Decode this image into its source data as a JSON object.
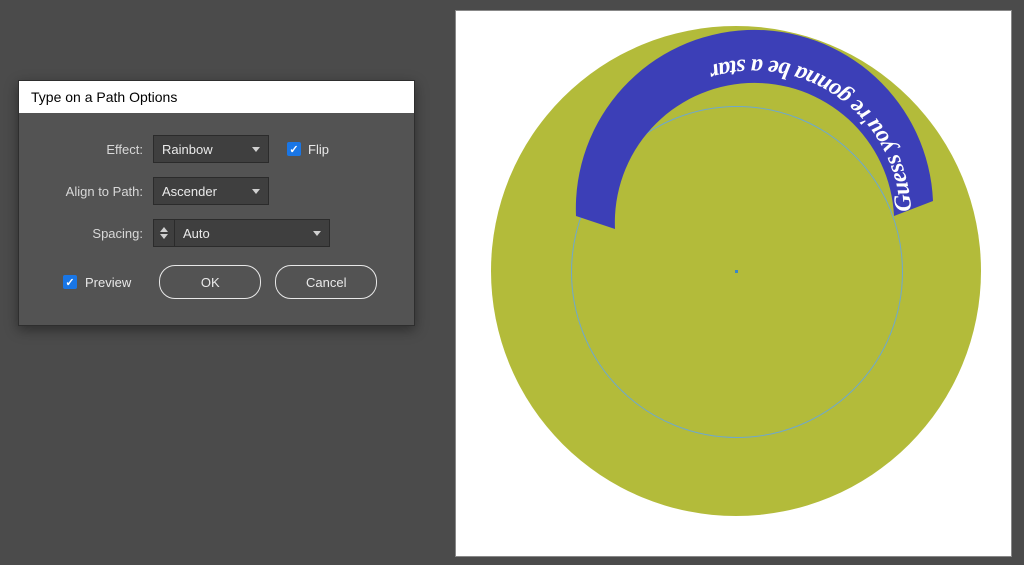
{
  "dialog": {
    "title": "Type on a Path Options",
    "effect_label": "Effect:",
    "effect_value": "Rainbow",
    "flip_label": "Flip",
    "flip_checked": true,
    "align_label": "Align to Path:",
    "align_value": "Ascender",
    "spacing_label": "Spacing:",
    "spacing_value": "Auto",
    "preview_label": "Preview",
    "preview_checked": true,
    "ok_label": "OK",
    "cancel_label": "Cancel"
  },
  "canvas": {
    "circle_color": "#b3bb3a",
    "arc_color": "#3c3fb7",
    "path_text": "Guess you're gonna be a star"
  }
}
